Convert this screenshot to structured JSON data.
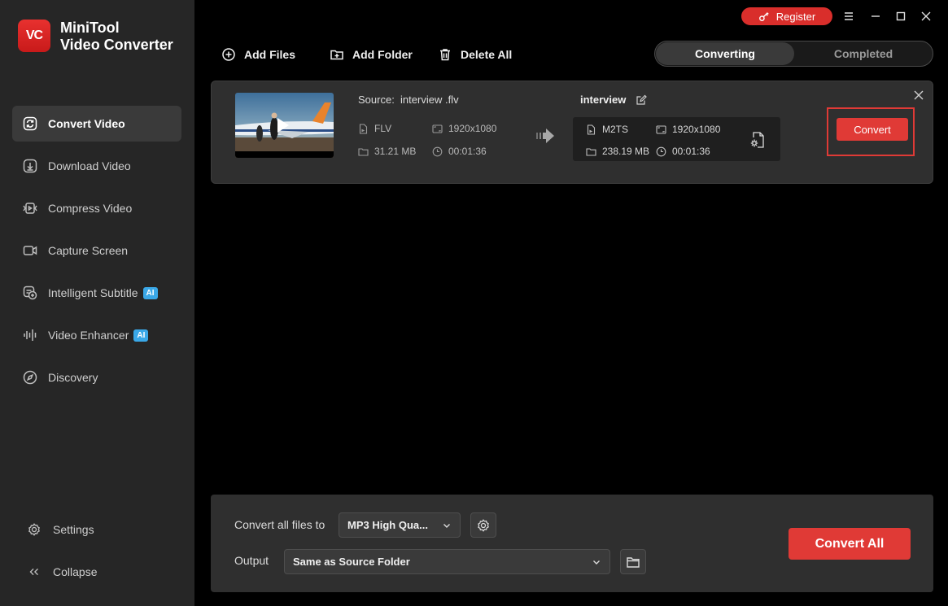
{
  "app": {
    "logo_text": "VC",
    "title_line1": "MiniTool",
    "title_line2": "Video Converter"
  },
  "sidebar": {
    "items": [
      {
        "label": "Convert Video",
        "icon": "convert-icon",
        "active": true
      },
      {
        "label": "Download Video",
        "icon": "download-icon"
      },
      {
        "label": "Compress Video",
        "icon": "compress-icon"
      },
      {
        "label": "Capture Screen",
        "icon": "camera-icon"
      },
      {
        "label": "Intelligent Subtitle",
        "icon": "subtitle-icon",
        "badge": "AI"
      },
      {
        "label": "Video Enhancer",
        "icon": "enhancer-icon",
        "badge": "AI"
      },
      {
        "label": "Discovery",
        "icon": "compass-icon"
      }
    ],
    "settings_label": "Settings",
    "collapse_label": "Collapse"
  },
  "titlebar": {
    "register_label": "Register"
  },
  "toolbar": {
    "add_files": "Add Files",
    "add_folder": "Add Folder",
    "delete_all": "Delete All"
  },
  "tabs": {
    "converting": "Converting",
    "completed": "Completed"
  },
  "file": {
    "source_label": "Source:",
    "source_name": "interview .flv",
    "format": "FLV",
    "resolution": "1920x1080",
    "size": "31.21 MB",
    "duration": "00:01:36",
    "output_name": "interview",
    "out_format": "M2TS",
    "out_resolution": "1920x1080",
    "out_size": "238.19 MB",
    "out_duration": "00:01:36",
    "convert_label": "Convert"
  },
  "bottom": {
    "convert_all_files_to_label": "Convert all files to",
    "format_value": "MP3 High Qua...",
    "output_label": "Output",
    "output_value": "Same as Source Folder",
    "convert_all_label": "Convert All"
  },
  "colors": {
    "accent": "#e03a36",
    "sidebar_bg": "#262626",
    "panel_bg": "#2f2f2f",
    "ai_badge": "#3aa8e8"
  }
}
